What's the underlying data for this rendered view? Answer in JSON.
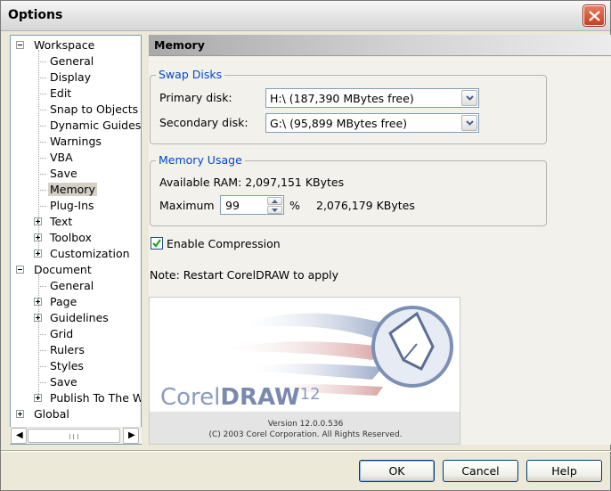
{
  "window": {
    "title": "Options",
    "close": "✕"
  },
  "tree": {
    "items": [
      {
        "label": "Workspace",
        "level": 0,
        "expander": "minus"
      },
      {
        "label": "General",
        "level": 1
      },
      {
        "label": "Display",
        "level": 1
      },
      {
        "label": "Edit",
        "level": 1
      },
      {
        "label": "Snap to Objects",
        "level": 1
      },
      {
        "label": "Dynamic Guides",
        "level": 1
      },
      {
        "label": "Warnings",
        "level": 1
      },
      {
        "label": "VBA",
        "level": 1
      },
      {
        "label": "Save",
        "level": 1
      },
      {
        "label": "Memory",
        "level": 1,
        "selected": true
      },
      {
        "label": "Plug-Ins",
        "level": 1
      },
      {
        "label": "Text",
        "level": 1,
        "expander": "plus"
      },
      {
        "label": "Toolbox",
        "level": 1,
        "expander": "plus"
      },
      {
        "label": "Customization",
        "level": 1,
        "expander": "plus"
      },
      {
        "label": "Document",
        "level": 0,
        "expander": "minus"
      },
      {
        "label": "General",
        "level": 1
      },
      {
        "label": "Page",
        "level": 1,
        "expander": "plus"
      },
      {
        "label": "Guidelines",
        "level": 1,
        "expander": "plus"
      },
      {
        "label": "Grid",
        "level": 1
      },
      {
        "label": "Rulers",
        "level": 1
      },
      {
        "label": "Styles",
        "level": 1
      },
      {
        "label": "Save",
        "level": 1
      },
      {
        "label": "Publish To The Web",
        "level": 1,
        "expander": "plus"
      },
      {
        "label": "Global",
        "level": 0,
        "expander": "plus"
      }
    ],
    "scroll_left": "◀",
    "scroll_right": "▶"
  },
  "content": {
    "header": "Memory",
    "swap": {
      "legend": "Swap Disks",
      "primary_label": "Primary disk:",
      "primary_value": "H:\\  (187,390 MBytes free)",
      "secondary_label": "Secondary disk:",
      "secondary_value": "G:\\  (95,899 MBytes free)"
    },
    "memory": {
      "legend": "Memory Usage",
      "available": "Available RAM:  2,097,151 KBytes",
      "maximum_label": "Maximum",
      "maximum_value": "99",
      "percent": "%",
      "maximum_kbytes": "2,076,179 KBytes"
    },
    "compression": {
      "label": "Enable Compression",
      "checked": true
    },
    "note": "Note: Restart CorelDRAW to apply",
    "splash": {
      "logo_text": "CorelDRAW",
      "logo_version": "12",
      "version": "Version 12.0.0.536",
      "copyright": "(C) 2003 Corel Corporation. All Rights Reserved."
    }
  },
  "buttons": {
    "ok": "OK",
    "cancel": "Cancel",
    "help": "Help"
  },
  "colors": {
    "accent_blue": "#0046d5",
    "close_red": "#c9401f",
    "check_green": "#21a121"
  }
}
